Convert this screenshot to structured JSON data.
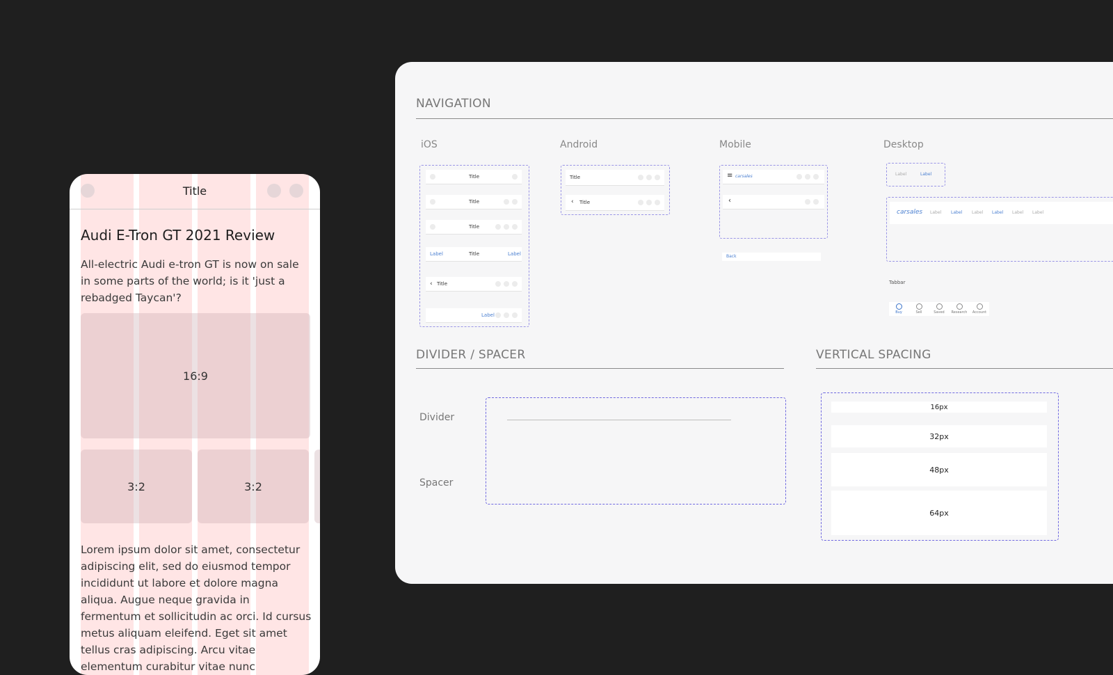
{
  "phone": {
    "nav_title": "Title",
    "article_title": "Audi E-Tron GT 2021 Review",
    "article_desc": "All-electric Audi e-tron GT is now on sale in some parts of the world; is it 'just a rebadged Taycan'?",
    "ratio_main": "16:9",
    "ratio_left": "3:2",
    "ratio_right": "3:2",
    "body": "Lorem ipsum dolor sit amet, consectetur adipiscing elit, sed do eiusmod tempor incididunt ut labore et dolore magna aliqua. Augue neque gravida in fermentum et sollicitudin ac orci. Id cursus metus aliquam eleifend. Eget sit amet tellus cras adipiscing. Arcu vitae elementum curabitur vitae nunc"
  },
  "panel": {
    "navigation_title": "NAVIGATION",
    "platforms": {
      "ios": "iOS",
      "android": "Android",
      "mobile": "Mobile",
      "desktop": "Desktop"
    },
    "ios": {
      "title": "Title",
      "label": "Label"
    },
    "android": {
      "title": "Title"
    },
    "mobile": {
      "logo": "carsales",
      "back": "Back"
    },
    "desktop": {
      "label": "Label",
      "logo": "carsales",
      "tabbar_label": "Tabbar",
      "tabbar_items": [
        "Buy",
        "Sell",
        "Saved",
        "Research",
        "Account"
      ]
    },
    "divider_title": "DIVIDER / SPACER",
    "divider_label": "Divider",
    "spacer_label": "Spacer",
    "vertical_title": "VERTICAL SPACING",
    "spacings": [
      "16px",
      "32px",
      "48px",
      "64px"
    ]
  },
  "colors": {
    "background": "#1f1f1f",
    "column_overlay": "#ff5f5f",
    "dashed_border": "#6f68e0",
    "link": "#4a7fd0"
  }
}
